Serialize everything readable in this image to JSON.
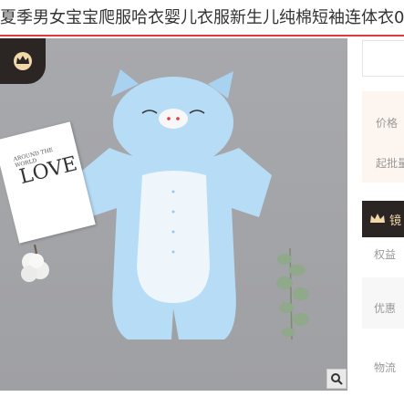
{
  "product": {
    "title": "夏季男女宝宝爬服哈衣婴儿衣服新生儿纯棉短袖连体衣0"
  },
  "image": {
    "card_text_top": "AROUND THE WORLD",
    "card_text_main": "LOVE",
    "zoom_icon": "search-icon"
  },
  "panel": {
    "price_label": "价格",
    "wholesale_label": "起批量",
    "shop_name": "镜",
    "benefit_label": "权益",
    "coupon_label": "优惠",
    "logistics_label": "物流"
  },
  "colors": {
    "accent": "#e4393c",
    "shop_badge_bg": "#2b2624",
    "shop_gold": "#f1d8a8",
    "garment_blue": "#b7dcf6"
  }
}
